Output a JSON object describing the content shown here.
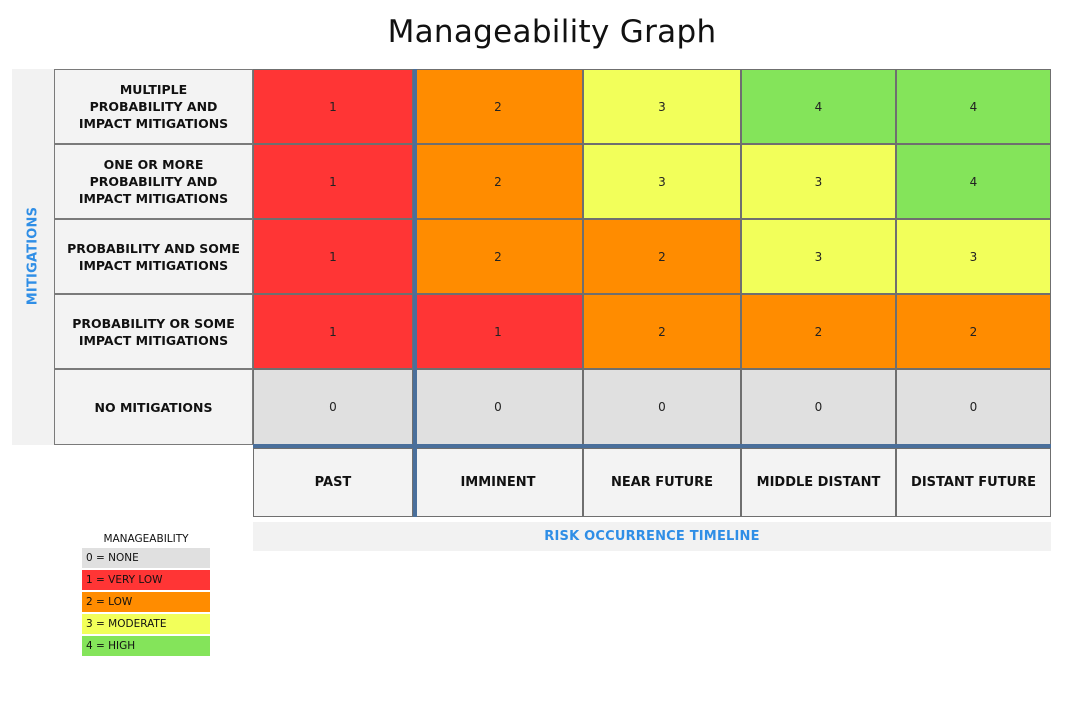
{
  "chart_data": {
    "type": "heatmap",
    "title": "Manageability Graph",
    "ylabel": "MITIGATIONS",
    "xlabel": "RISK OCCURRENCE TIMELINE",
    "x_categories": [
      "PAST",
      "IMMINENT",
      "NEAR FUTURE",
      "MIDDLE DISTANT",
      "DISTANT FUTURE"
    ],
    "y_categories": [
      "MULTIPLE\nPROBABILITY AND\nIMPACT MITIGATIONS",
      "ONE OR MORE\nPROBABILITY AND\nIMPACT MITIGATIONS",
      "PROBABILITY AND SOME\nIMPACT MITIGATIONS",
      "PROBABILITY OR SOME\nIMPACT MITIGATIONS",
      "NO MITIGATIONS"
    ],
    "values": [
      [
        1,
        2,
        3,
        4,
        4
      ],
      [
        1,
        2,
        3,
        3,
        4
      ],
      [
        1,
        2,
        2,
        3,
        3
      ],
      [
        1,
        1,
        2,
        2,
        2
      ],
      [
        0,
        0,
        0,
        0,
        0
      ]
    ],
    "color_scale": {
      "0": "#e0e0e0",
      "1": "#ff3535",
      "2": "#ff8c00",
      "3": "#f2ff5a",
      "4": "#84e45a"
    },
    "legend": {
      "title": "MANAGEABILITY",
      "position": "bottom-left",
      "items": [
        {
          "label": "0 = NONE",
          "value": 0
        },
        {
          "label": "1 = VERY LOW",
          "value": 1
        },
        {
          "label": "2 = LOW",
          "value": 2
        },
        {
          "label": "3 = MODERATE",
          "value": 3
        },
        {
          "label": "4 = HIGH",
          "value": 4
        }
      ]
    }
  }
}
